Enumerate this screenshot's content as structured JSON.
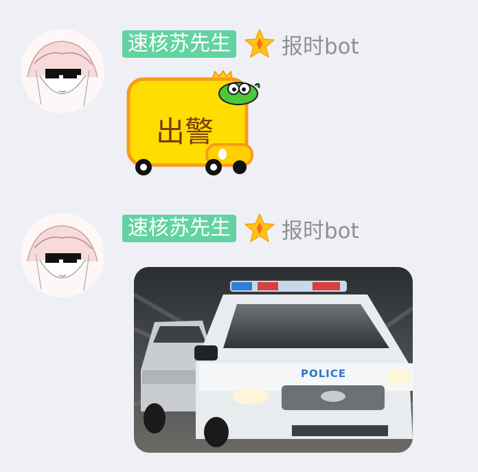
{
  "messages": [
    {
      "sender": "速核苏先生",
      "role": "报时bot",
      "sticker_text": "出警"
    },
    {
      "sender": "速核苏先生",
      "role": "报时bot",
      "image_text": "POLICE"
    }
  ],
  "colors": {
    "background": "#eff0f5",
    "title_badge": "#62d3a1",
    "role_text": "#8e9098",
    "sticker_yellow": "#ffdd00",
    "sticker_border": "#f79a1e"
  }
}
